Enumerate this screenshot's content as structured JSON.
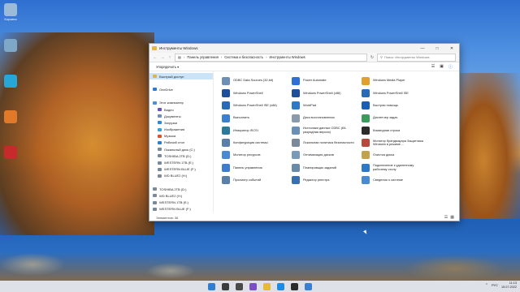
{
  "desktop": {
    "icons": [
      {
        "label": "Корзина",
        "color": "#9bbbd6"
      },
      {
        "label": "",
        "color": "#7fa7c8"
      },
      {
        "label": "",
        "color": "#27a6d8"
      },
      {
        "label": "",
        "color": "#e07a2a"
      },
      {
        "label": "",
        "color": "#c62a2a"
      }
    ]
  },
  "back_window_title": "Система и безопасность",
  "window": {
    "title": "Инструменты Windows",
    "breadcrumbs": [
      "Панель управления",
      "Система и безопасность",
      "Инструменты Windows"
    ],
    "search_placeholder": "Поиск: Инструменты Windows",
    "sort_label": "Упорядочить ▾",
    "status_text": "Элементов: 36",
    "sidebar": [
      {
        "label": "Быстрый доступ",
        "color": "#e3b341",
        "selected": true
      },
      {
        "label": "",
        "color": "#ffffff",
        "selected": false
      },
      {
        "label": "OneDrive",
        "color": "#2a7ad6",
        "selected": false
      },
      {
        "label": "",
        "color": "#ffffff",
        "selected": false
      },
      {
        "label": "Этот компьютер",
        "color": "#4a90d9",
        "selected": false
      },
      {
        "label": "Видео",
        "color": "#6b4fc2",
        "selected": false
      },
      {
        "label": "Документы",
        "color": "#6d8fb5",
        "selected": false
      },
      {
        "label": "Загрузки",
        "color": "#2e8ad6",
        "selected": false
      },
      {
        "label": "Изображения",
        "color": "#3aa0d8",
        "selected": false
      },
      {
        "label": "Музыка",
        "color": "#d9562f",
        "selected": false
      },
      {
        "label": "Рабочий стол",
        "color": "#2f7fd1",
        "selected": false
      },
      {
        "label": "Локальный диск (C:)",
        "color": "#7b8a99",
        "selected": false
      },
      {
        "label": "TOSHIBA 2TB (D:)",
        "color": "#7b8a99",
        "selected": false
      },
      {
        "label": "WESTERN 1TB (E:)",
        "color": "#7b8a99",
        "selected": false
      },
      {
        "label": "WESTERN BLUE (F:)",
        "color": "#7b8a99",
        "selected": false
      },
      {
        "label": "WD BLUE2 (H:)",
        "color": "#7b8a99",
        "selected": false
      },
      {
        "label": "",
        "color": "#ffffff",
        "selected": false
      },
      {
        "label": "TOSHIBA 2TB (D:)",
        "color": "#7b8a99",
        "selected": false
      },
      {
        "label": "WD BLUE2 (H:)",
        "color": "#7b8a99",
        "selected": false
      },
      {
        "label": "WESTERN 1TB (E:)",
        "color": "#7b8a99",
        "selected": false
      },
      {
        "label": "WESTERN BLUE (F:)",
        "color": "#7b8a99",
        "selected": false
      }
    ],
    "items": [
      {
        "label": "ODBC Data Sources (32-bit)",
        "color": "#6b8fb5"
      },
      {
        "label": "Power Automate",
        "color": "#2f6fd6"
      },
      {
        "label": "Windows Media Player",
        "color": "#e0a030"
      },
      {
        "label": "Windows PowerShell",
        "color": "#1f4f9a"
      },
      {
        "label": "Windows PowerShell (x86)",
        "color": "#1f4f9a"
      },
      {
        "label": "Windows PowerShell ISE",
        "color": "#2a6bb8"
      },
      {
        "label": "Windows PowerShell ISE (x86)",
        "color": "#2a6bb8"
      },
      {
        "label": "WordPad",
        "color": "#2e79c7"
      },
      {
        "label": "Быстрая помощь",
        "color": "#1a5fb5"
      },
      {
        "label": "Выполнить",
        "color": "#3b7fd0"
      },
      {
        "label": "Диск восстановления",
        "color": "#8a9bab"
      },
      {
        "label": "Диспетчер задач",
        "color": "#3a9b5a"
      },
      {
        "label": "Инициатор iSCSI",
        "color": "#2a7a9a"
      },
      {
        "label": "Источники данных ODBC (64-разрядная версия)",
        "color": "#6b8fb5"
      },
      {
        "label": "Командная строка",
        "color": "#2b2b2b"
      },
      {
        "label": "Конфигурация системы",
        "color": "#5a7fa8"
      },
      {
        "label": "Локальная политика безопасности",
        "color": "#7a8a9a"
      },
      {
        "label": "Монитор брандмауэра Защитника Windows в режиме ...",
        "color": "#b54a3a"
      },
      {
        "label": "Монитор ресурсов",
        "color": "#4a8ad0"
      },
      {
        "label": "Оптимизация дисков",
        "color": "#7a9ab8"
      },
      {
        "label": "Очистка диска",
        "color": "#c2a24a"
      },
      {
        "label": "Панель управления",
        "color": "#3f7bd0"
      },
      {
        "label": "Планировщик заданий",
        "color": "#6a8aa8"
      },
      {
        "label": "Подключение к удаленному рабочему столу",
        "color": "#2e79c7"
      },
      {
        "label": "Просмотр событий",
        "color": "#5a7fa8"
      },
      {
        "label": "Редактор реестра",
        "color": "#3a6fb0"
      },
      {
        "label": "Сведения о системе",
        "color": "#4a8ad0"
      }
    ]
  },
  "taskbar": {
    "apps": [
      "#2f7fd1",
      "#3b3b3b",
      "#4a4a4a",
      "#7b4fc2",
      "#e8b83b",
      "#1f8be0",
      "#2b2b2b",
      "#3a7fd0"
    ],
    "time": "11:13",
    "date": "15.07.2022",
    "lang": "РУС"
  }
}
